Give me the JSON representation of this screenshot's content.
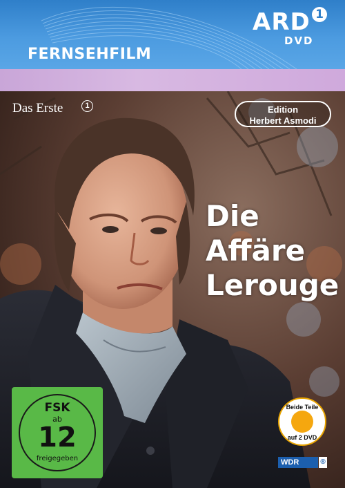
{
  "header": {
    "series_label": "FERNSEHFILM",
    "brand": "ARD",
    "brand_one": "1",
    "format": "DVD"
  },
  "broadcaster": {
    "name": "Das Erste",
    "one": "1"
  },
  "edition": {
    "line1": "Edition",
    "line2": "Herbert Asmodi"
  },
  "title": {
    "line1": "Die",
    "line2": "Affäre",
    "line3": "Lerouge"
  },
  "rating": {
    "top": "FSK",
    "small": "ab",
    "age": "12",
    "bottom": "freigegeben",
    "color": "#59b947"
  },
  "sticker": {
    "top": "Beide Teile",
    "bottom": "auf 2 DVD",
    "color": "#f5a70f"
  },
  "producer": {
    "name": "WDR",
    "mark": "®"
  },
  "colors": {
    "header_blue": "#2f7fc9",
    "strip_purple": "#d8b9e2"
  }
}
